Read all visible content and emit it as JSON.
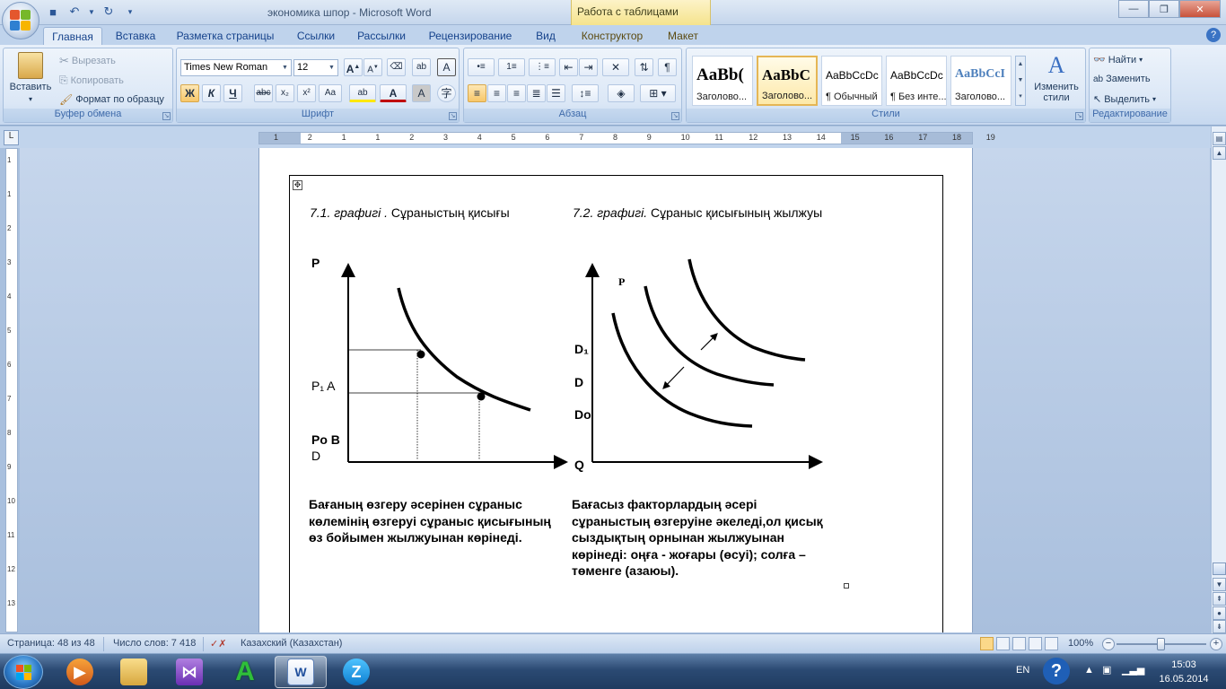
{
  "window": {
    "title": "экономика шпор - Microsoft Word",
    "context_tab": "Работа с таблицами"
  },
  "tabs": [
    "Главная",
    "Вставка",
    "Разметка страницы",
    "Ссылки",
    "Рассылки",
    "Рецензирование",
    "Вид",
    "Конструктор",
    "Макет"
  ],
  "ribbon": {
    "clipboard": {
      "label": "Буфер обмена",
      "paste": "Вставить",
      "cut": "Вырезать",
      "copy": "Копировать",
      "format_painter": "Формат по образцу"
    },
    "font": {
      "label": "Шрифт",
      "font_name": "Times New Roman",
      "font_size": "12",
      "bold": "Ж",
      "italic": "К",
      "underline": "Ч",
      "strike": "abc",
      "subscript": "x₂",
      "superscript": "x²",
      "change_case": "Aa",
      "grow": "A",
      "shrink": "A",
      "highlight": "ab",
      "font_color": "A"
    },
    "paragraph": {
      "label": "Абзац"
    },
    "styles": {
      "label": "Стили",
      "items": [
        {
          "sample": "AaBb(",
          "name": "Заголово..."
        },
        {
          "sample": "AaBbC",
          "name": "Заголово..."
        },
        {
          "sample": "AaBbCcDc",
          "name": "¶ Обычный"
        },
        {
          "sample": "AaBbCcDc",
          "name": "¶ Без инте..."
        },
        {
          "sample": "AaBbCcI",
          "name": "Заголово..."
        }
      ],
      "change_styles": "Изменить стили"
    },
    "editing": {
      "label": "Редактирование",
      "find": "Найти",
      "replace": "Заменить",
      "select": "Выделить"
    }
  },
  "ruler": {
    "numbers": [
      "1",
      "2",
      "1",
      "1",
      "2",
      "3",
      "4",
      "5",
      "6",
      "7",
      "8",
      "9",
      "10",
      "11",
      "12",
      "13",
      "14",
      "15",
      "16",
      "17",
      "18",
      "19"
    ],
    "vnumbers": [
      "1",
      "1",
      "2",
      "3",
      "4",
      "5",
      "6",
      "7",
      "8",
      "9",
      "10",
      "11",
      "12",
      "13"
    ]
  },
  "document": {
    "left": {
      "caption_italic": "7.1. графигі .",
      "caption_rest": " Сұраныстың қисығы",
      "label_p": "P",
      "label_p1a": "P₁ A",
      "label_pob": "Po B",
      "label_d": "D",
      "paragraph": "Бағаның өзгеру әсерінен сұраныс көлемінің өзгеруі сұраныс қисығының өз бойымен жылжуынан көрінеді."
    },
    "right": {
      "caption_italic": "7.2. графигі.",
      "caption_rest": " Сұраныс қисығының жылжуы",
      "label_p": "P",
      "label_d1": "D₁",
      "label_d": "D",
      "label_do": "Do",
      "label_q": "Q",
      "paragraph": "Бағасыз факторлардың әсері сұраныстың өзгеруіне әкеледі,ол қисық сыздықтың орнынан жылжуынан көрінеді: оңға - жоғары (өсуі); солға – төменге (азаюы)."
    }
  },
  "status": {
    "page": "Страница: 48 из 48",
    "words": "Число слов: 7 418",
    "language": "Казахский (Казахстан)",
    "zoom": "100%"
  },
  "taskbar": {
    "lang": "EN",
    "time": "15:03",
    "date": "16.05.2014"
  }
}
